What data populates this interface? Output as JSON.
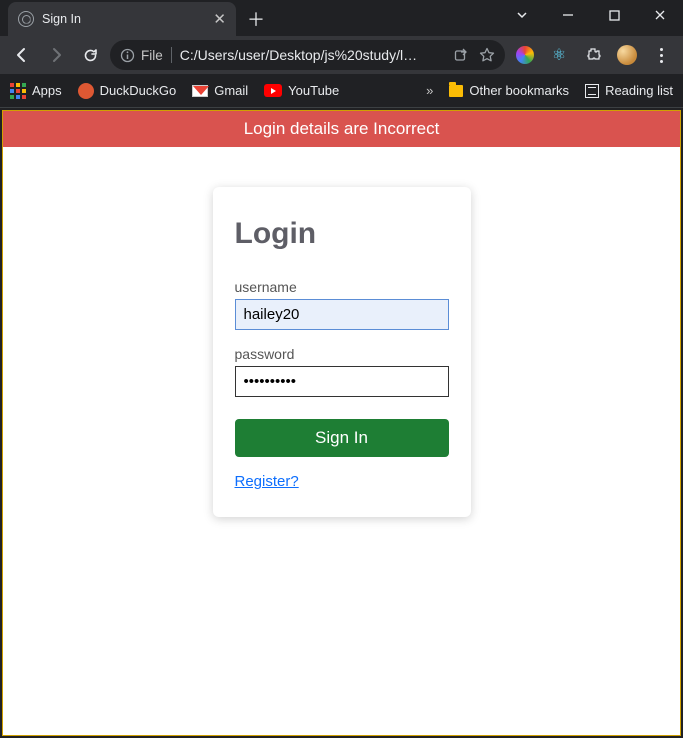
{
  "window": {
    "tab_title": "Sign In"
  },
  "omnibox": {
    "scheme_label": "File",
    "url": "C:/Users/user/Desktop/js%20study/logi..."
  },
  "bookmarks": {
    "apps": "Apps",
    "ddg": "DuckDuckGo",
    "gmail": "Gmail",
    "youtube": "YouTube",
    "other": "Other bookmarks",
    "reading": "Reading list"
  },
  "page": {
    "banner": "Login details are Incorrect",
    "heading": "Login",
    "username_label": "username",
    "username_value": "hailey20",
    "password_label": "password",
    "password_value": "••••••••••",
    "signin_label": "Sign In",
    "register_label": "Register?"
  }
}
